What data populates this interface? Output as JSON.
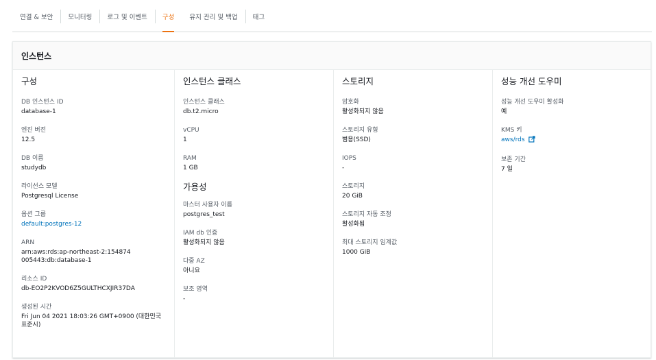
{
  "tabs": [
    {
      "label": "연결 & 보안"
    },
    {
      "label": "모니터링"
    },
    {
      "label": "로그 및 이벤트"
    },
    {
      "label": "구성"
    },
    {
      "label": "유지 관리 및 백업"
    },
    {
      "label": "태그"
    }
  ],
  "active_tab": "구성",
  "colors": {
    "accent": "#ec7211",
    "link": "#0073bb"
  },
  "panel": {
    "title": "인스턴스"
  },
  "config": {
    "title": "구성",
    "fields": [
      {
        "label": "DB 인스턴스 ID",
        "value": "database-1"
      },
      {
        "label": "엔진 버전",
        "value": "12.5"
      },
      {
        "label": "DB 이름",
        "value": "studydb"
      },
      {
        "label": "라이선스 모델",
        "value": "Postgresql License"
      },
      {
        "label": "옵션 그룹",
        "value": "default:postgres-12"
      },
      {
        "label": "ARN",
        "value": "arn:aws:rds:ap-northeast-2:154874005443:db:database-1"
      },
      {
        "label": "리소스 ID",
        "value": "db-EO2P2KVOD6Z5GULTHCXJIR37DA"
      },
      {
        "label": "생성된 시간",
        "value": "Fri Jun 04 2021 18:03:26 GMT+0900 (대한민국 표준시)"
      }
    ]
  },
  "instance_class": {
    "title": "인스턴스 클래스",
    "fields": [
      {
        "label": "인스턴스 클래스",
        "value": "db.t2.micro"
      },
      {
        "label": "vCPU",
        "value": "1"
      },
      {
        "label": "RAM",
        "value": "1 GB"
      }
    ]
  },
  "availability": {
    "title": "가용성",
    "fields": [
      {
        "label": "마스터 사용자 이름",
        "value": "postgres_test"
      },
      {
        "label": "IAM db 인증",
        "value": "활성화되지 않음"
      },
      {
        "label": "다중 AZ",
        "value": "아니요"
      },
      {
        "label": "보조 영역",
        "value": "-"
      }
    ]
  },
  "storage": {
    "title": "스토리지",
    "fields": [
      {
        "label": "암호화",
        "value": "활성화되지 않음"
      },
      {
        "label": "스토리지 유형",
        "value": "범용(SSD)"
      },
      {
        "label": "IOPS",
        "value": "-"
      },
      {
        "label": "스토리지",
        "value": "20 GiB"
      },
      {
        "label": "스토리지 자동 조정",
        "value": "활성화됨"
      },
      {
        "label": "최대 스토리지 임계값",
        "value": "1000 GiB"
      }
    ]
  },
  "performance_insights": {
    "title": "성능 개선 도우미",
    "fields": [
      {
        "label": "성능 개선 도우미 활성화",
        "value": "예"
      },
      {
        "label": "KMS 키",
        "value": "aws/rds",
        "icon": "external-link-icon"
      },
      {
        "label": "보존 기간",
        "value": "7 일"
      }
    ]
  }
}
